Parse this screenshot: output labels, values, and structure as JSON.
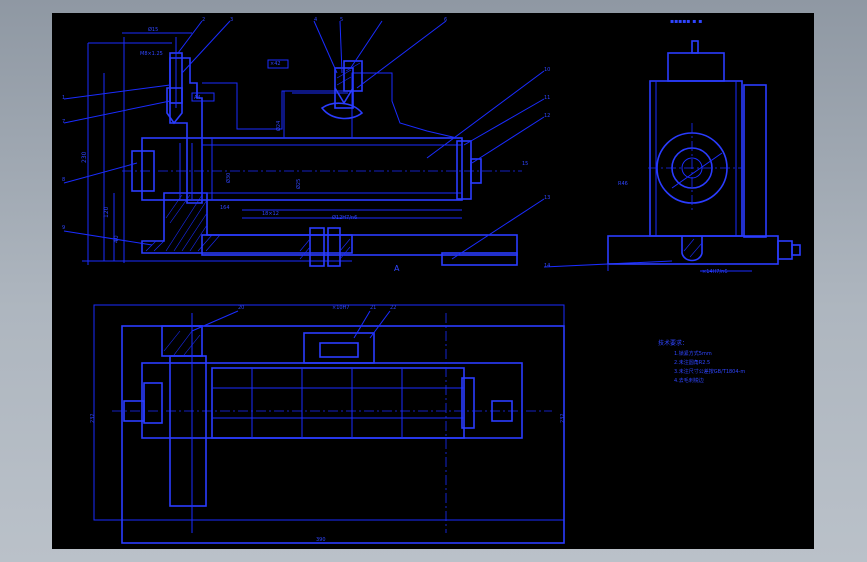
{
  "drawing": {
    "title_mark": "▪▪▪▪▪ ▪ ▪",
    "section_mark": "A",
    "balloons_front": [
      "2",
      "3",
      "4",
      "5",
      "6",
      "1",
      "7",
      "8",
      "9",
      "10",
      "11",
      "12",
      "13",
      "14",
      "15"
    ],
    "dims_front": {
      "top_a": "Ø15",
      "top_b": "M8×1.25",
      "left_v1": "230",
      "left_v2": "120",
      "left_v3": "40",
      "mid_a": "Ø30",
      "mid_b": "Ø25",
      "mid_c": "Ø24",
      "mid_d": "164",
      "mid_e": "18×12",
      "label_b1": "A4",
      "label_b2": "×42",
      "bot_a": "Ø12H7/n6"
    },
    "dims_side": {
      "radius_label": "R46",
      "base_label": "×14H7/n6"
    },
    "balloons_top": [
      "20",
      "21",
      "22"
    ],
    "dims_top": {
      "width": "390",
      "left_h": "232",
      "right_h": "232",
      "top_small": "×10H7"
    },
    "notes": {
      "heading": "技术要求：",
      "lines": [
        "1.锁紧方式5mm",
        "2.未注圆角R2.5",
        "3.未注尺寸公差按GB/T1804-m",
        "4.去毛刺锐边"
      ]
    }
  },
  "colors": {
    "paper": "#000000",
    "line": "#1a2cff",
    "frame": "#9aa3ad"
  }
}
